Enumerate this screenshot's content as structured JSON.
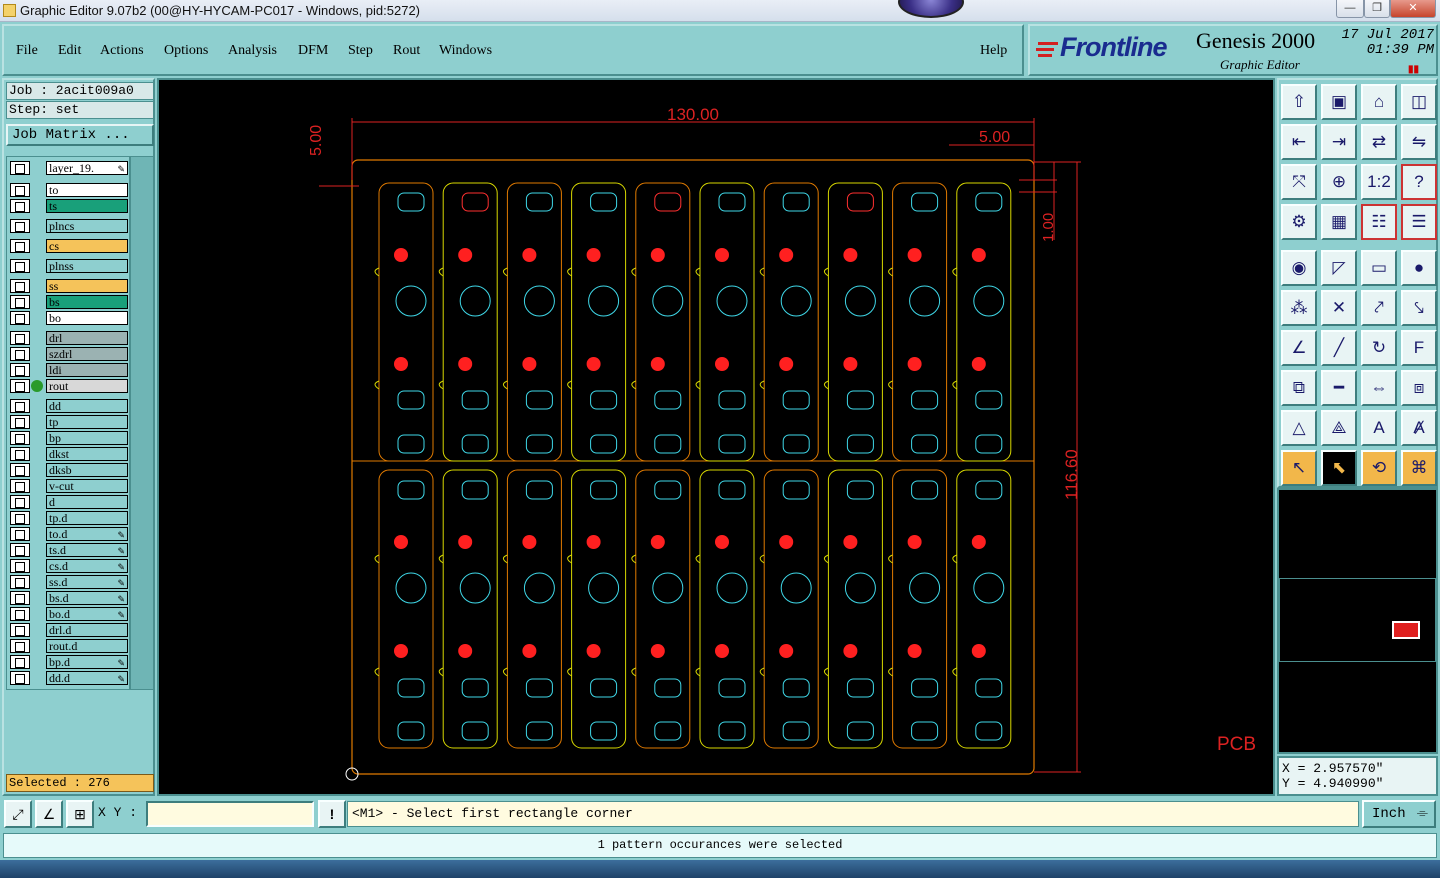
{
  "window": {
    "title": "Graphic Editor 9.07b2 (00@HY-HYCAM-PC017 - Windows, pid:5272)"
  },
  "menu": {
    "file": "File",
    "edit": "Edit",
    "actions": "Actions",
    "options": "Options",
    "analysis": "Analysis",
    "dfm": "DFM",
    "step": "Step",
    "rout": "Rout",
    "windows": "Windows",
    "help": "Help"
  },
  "brand": {
    "logo": "Frontline",
    "product": "Genesis 2000",
    "subtitle": "Graphic Editor",
    "date": "17 Jul 2017",
    "time": "01:39 PM"
  },
  "job": {
    "job_line": "Job : 2acit009a0",
    "step_line": "Step: set",
    "job_matrix": "Job Matrix ..."
  },
  "layers": [
    {
      "name": "layer_19.",
      "color": "#1a1a8a",
      "dot": "",
      "icon": "✎"
    },
    {
      "name": "to",
      "color": "#ffffff",
      "dot": ""
    },
    {
      "name": "ts",
      "color": "#19a07a",
      "dot": ""
    },
    {
      "name": "plncs",
      "color": "#8ecfcf",
      "dot": ""
    },
    {
      "name": "cs",
      "color": "#f5c35a",
      "dot": ""
    },
    {
      "name": "plnss",
      "color": "#8ecfcf",
      "dot": ""
    },
    {
      "name": "ss",
      "color": "#f5c35a",
      "dot": ""
    },
    {
      "name": "bs",
      "color": "#19a07a",
      "dot": ""
    },
    {
      "name": "bo",
      "color": "#ffffff",
      "dot": ""
    },
    {
      "name": "drl",
      "color": "#9bb2b2",
      "dot": ""
    },
    {
      "name": "szdrl",
      "color": "#9bb2b2",
      "dot": ""
    },
    {
      "name": "ldi",
      "color": "#9bb2b2",
      "dot": ""
    },
    {
      "name": "rout",
      "color": "#d8d8d8",
      "dot": "#2a9a2a"
    },
    {
      "name": "dd",
      "color": "#8ecfcf",
      "dot": ""
    },
    {
      "name": "tp",
      "color": "#8ecfcf",
      "dot": ""
    },
    {
      "name": "bp",
      "color": "#8ecfcf",
      "dot": ""
    },
    {
      "name": "dkst",
      "color": "#8ecfcf",
      "dot": ""
    },
    {
      "name": "dksb",
      "color": "#8ecfcf",
      "dot": ""
    },
    {
      "name": "v-cut",
      "color": "#8ecfcf",
      "dot": ""
    },
    {
      "name": "d",
      "color": "#8ecfcf",
      "dot": ""
    },
    {
      "name": "tp.d",
      "color": "#8ecfcf",
      "dot": ""
    },
    {
      "name": "to.d",
      "color": "#8ecfcf",
      "dot": "",
      "icon": "✎"
    },
    {
      "name": "ts.d",
      "color": "#8ecfcf",
      "dot": "",
      "icon": "✎"
    },
    {
      "name": "cs.d",
      "color": "#8ecfcf",
      "dot": "",
      "icon": "✎"
    },
    {
      "name": "ss.d",
      "color": "#8ecfcf",
      "dot": "",
      "icon": "✎"
    },
    {
      "name": "bs.d",
      "color": "#8ecfcf",
      "dot": "",
      "icon": "✎"
    },
    {
      "name": "bo.d",
      "color": "#8ecfcf",
      "dot": "",
      "icon": "✎"
    },
    {
      "name": "drl.d",
      "color": "#8ecfcf",
      "dot": ""
    },
    {
      "name": "rout.d",
      "color": "#8ecfcf",
      "dot": ""
    },
    {
      "name": "bp.d",
      "color": "#8ecfcf",
      "dot": "",
      "icon": "✎"
    },
    {
      "name": "dd.d",
      "color": "#8ecfcf",
      "dot": "",
      "icon": "✎"
    }
  ],
  "selected": "Selected : 276",
  "drawing": {
    "dim_width": "130.00",
    "dim_small_top": "5.00",
    "dim_left_vertical": "5.00",
    "dim_right_vertical_small": "1.00",
    "dim_height": "116.60",
    "label": "PCB",
    "columns": 10,
    "row_blocks": 2,
    "colors": {
      "outline": "#e07a00",
      "rout": "#d8d800",
      "pad": "#3fd8e8",
      "drill": "#ff2020",
      "dim": "#dd2222"
    }
  },
  "coords": {
    "x": "X = 2.957570\"",
    "y": "Y = 4.940990\""
  },
  "command": {
    "xy_label": "X Y :",
    "xy_value": "",
    "prompt": "<M1> - Select first rectangle corner",
    "units": "Inch"
  },
  "status": "1 pattern occurances were selected",
  "tools": [
    "open-step-icon",
    "save-icon",
    "home-icon",
    "window-icon",
    "undo-icon",
    "redo-icon",
    "mirror-icon",
    "swap-icon",
    "fit-icon",
    "zoom-icon",
    "scale-1-2-icon",
    "help-icon",
    "settings-icon",
    "grid-icon",
    "layers-icon",
    "properties-icon",
    "add-pad-icon",
    "add-line-icon",
    "measure-icon",
    "add-circle-icon",
    "connect-icon",
    "delete-icon",
    "move-point-icon",
    "edit-point-icon",
    "angle-icon",
    "line-icon",
    "arc-icon",
    "text-icon",
    "copy-icon",
    "split-icon",
    "resize-icon",
    "group-icon",
    "triangle-icon",
    "triangle-outline-icon",
    "feature-a-icon",
    "feature-a2-icon",
    "select-icon",
    "select-box-icon",
    "select-rotate-icon",
    "route-icon"
  ]
}
